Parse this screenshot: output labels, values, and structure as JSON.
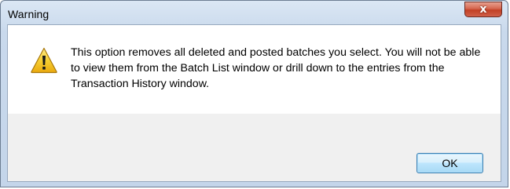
{
  "window": {
    "title": "Warning",
    "close_symbol": "x"
  },
  "dialog": {
    "icon": "warning-icon",
    "message": "This option removes all deleted and posted batches you select.  You will not be able to view them from the Batch List window or drill down to the entries from the Transaction History window."
  },
  "buttons": {
    "ok_label": "OK"
  },
  "colors": {
    "close_button": "#c84a33",
    "ok_border": "#3c7fb1",
    "warning_fill": "#f5c322"
  }
}
